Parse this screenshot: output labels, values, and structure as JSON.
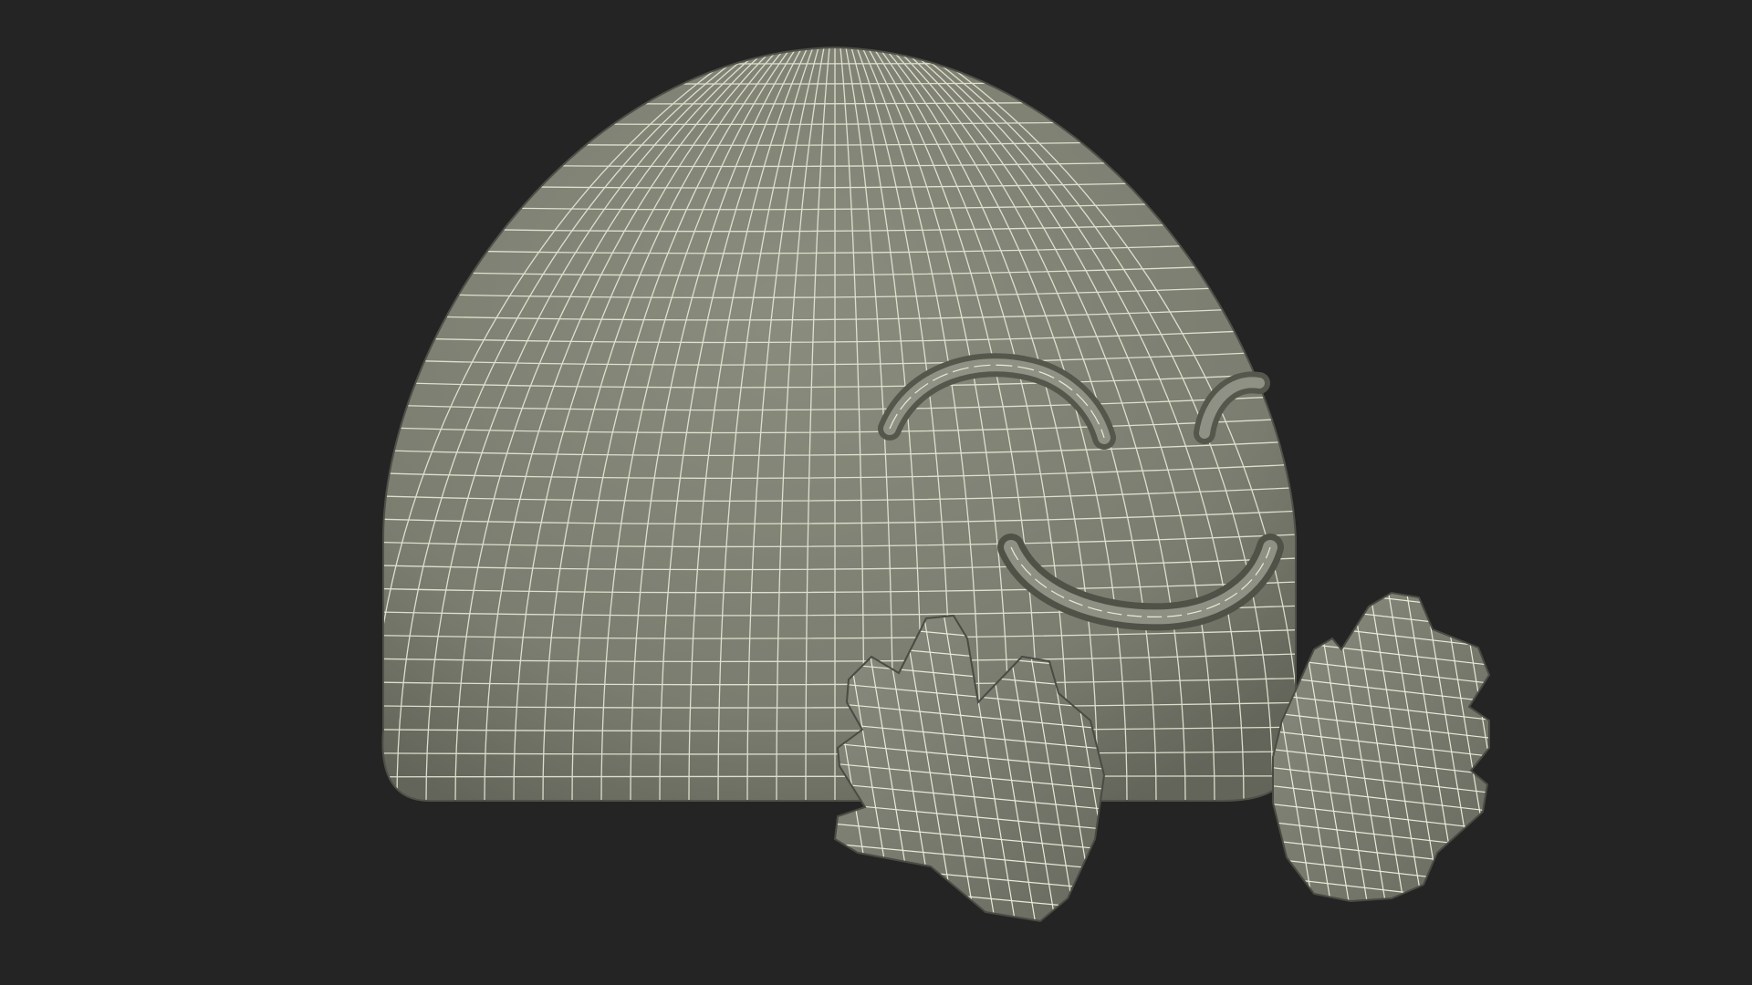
{
  "scene": {
    "background_color": "#242424",
    "surface_color": "#7d7f72",
    "surface_shadow_color": "#5f6157",
    "wire_color": "#e9ead8",
    "objects": [
      "emoji-face-mesh",
      "left-hand-mesh",
      "right-hand-mesh"
    ],
    "render_style": "wireframe-over-shaded"
  }
}
